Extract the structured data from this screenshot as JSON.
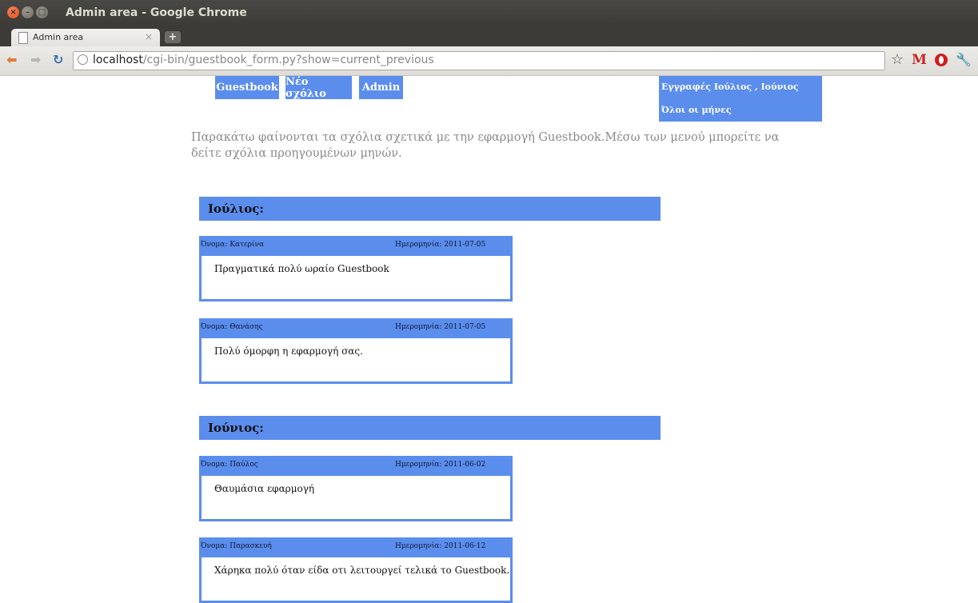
{
  "window": {
    "title": "Admin area - Google Chrome",
    "close_glyph": "×",
    "min_glyph": "–",
    "max_glyph": "□"
  },
  "tab": {
    "title": "Admin area",
    "close_glyph": "×",
    "new_tab_glyph": "+"
  },
  "toolbar": {
    "back_glyph": "⬅",
    "forward_glyph": "➡",
    "reload_glyph": "↻",
    "url_host": "localhost",
    "url_path": "/cgi-bin/guestbook_form.py?show=current_previous",
    "star_glyph": "☆",
    "gmail_glyph": "M",
    "wrench_glyph": "🔧"
  },
  "nav": {
    "guestbook": "Guestbook",
    "new_comment": "Νέο σχόλιο",
    "admin": "Admin",
    "months_current": "Εγγραφές Ιούλιος , Ιούνιος",
    "months_all": "Όλοι οι μήνες"
  },
  "intro": "Παρακάτω φαίνονται τα σχόλια σχετικά με την εφαρμογή Guestbook.Μέσω των μενού μπορείτε να δείτε σχόλια προηγουμένων μηνών.",
  "months": [
    {
      "title": "Ιούλιος:",
      "entries": [
        {
          "name": "Όνομα: Κατερίνα",
          "date": "Ημερομηνία: 2011-07-05",
          "text": "Πραγματικά πολύ ωραίο Guestbook"
        },
        {
          "name": "Όνομα: Θανάσης",
          "date": "Ημερομηνία: 2011-07-05",
          "text": "Πολύ όμορφη η εφαρμογή σας."
        }
      ]
    },
    {
      "title": "Ιούνιος:",
      "entries": [
        {
          "name": "Όνομα: Παύλος",
          "date": "Ημερομηνία: 2011-06-02",
          "text": "Θαυμάσια εφαρμογή"
        },
        {
          "name": "Όνομα: Παρασκευή",
          "date": "Ημερομηνία: 2011-06-12",
          "text": "Χάρηκα πολύ όταν είδα οτι λειτουργεί τελικά το Guestbook."
        }
      ]
    }
  ],
  "colors": {
    "accent": "#5b8ded",
    "titlebar": "#3c3b37",
    "intro_text": "#8a8a8a"
  }
}
